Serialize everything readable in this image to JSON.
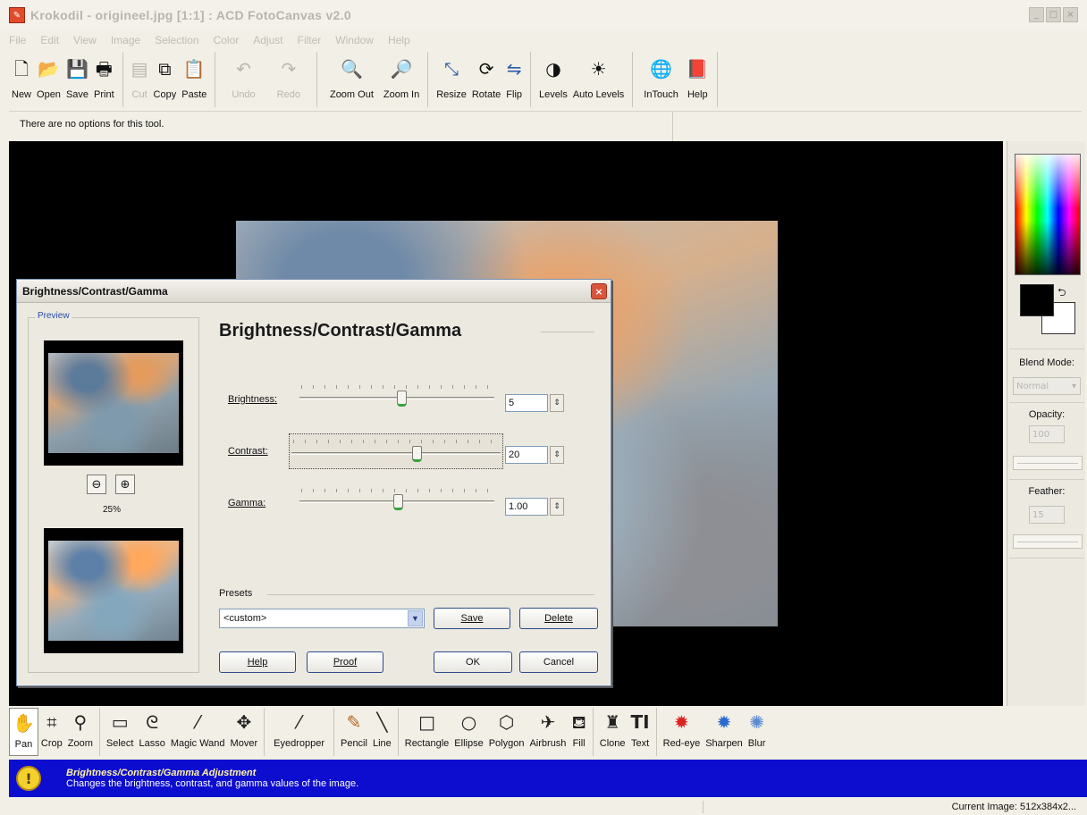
{
  "window": {
    "title": "Krokodil - origineel.jpg [1:1] : ACD FotoCanvas v2.0",
    "controls": [
      "_",
      "□",
      "×"
    ]
  },
  "menu": [
    "File",
    "Edit",
    "View",
    "Image",
    "Selection",
    "Color",
    "Adjust",
    "Filter",
    "Window",
    "Help"
  ],
  "toolbar": {
    "new": "New",
    "open": "Open",
    "save": "Save",
    "print": "Print",
    "cut": "Cut",
    "copy": "Copy",
    "paste": "Paste",
    "undo": "Undo",
    "redo": "Redo",
    "zoom_out": "Zoom Out",
    "zoom_in": "Zoom In",
    "resize": "Resize",
    "rotate": "Rotate",
    "flip": "Flip",
    "levels": "Levels",
    "auto_levels": "Auto Levels",
    "intouch": "InTouch",
    "help": "Help"
  },
  "options_bar": {
    "text": "There are no options for this tool."
  },
  "palette": {
    "blend_mode_label": "Blend Mode:",
    "blend_mode_value": "Normal",
    "opacity_label": "Opacity:",
    "opacity_value": "100",
    "feather_label": "Feather:",
    "feather_value": "15"
  },
  "tools": {
    "pan": "Pan",
    "crop": "Crop",
    "zoom": "Zoom",
    "select": "Select",
    "lasso": "Lasso",
    "magic_wand": "Magic Wand",
    "mover": "Mover",
    "eyedropper": "Eyedropper",
    "pencil": "Pencil",
    "line": "Line",
    "rectangle": "Rectangle",
    "ellipse": "Ellipse",
    "polygon": "Polygon",
    "airbrush": "Airbrush",
    "fill": "Fill",
    "clone": "Clone",
    "text": "Text",
    "red_eye": "Red-eye",
    "sharpen": "Sharpen",
    "blur": "Blur"
  },
  "hint": {
    "title": "Brightness/Contrast/Gamma Adjustment",
    "description": "Changes the brightness, contrast, and gamma values of the image."
  },
  "status": {
    "current_image": "Current Image: 512x384x2..."
  },
  "dialog": {
    "title": "Brightness/Contrast/Gamma",
    "heading": "Brightness/Contrast/Gamma",
    "preview_label": "Preview",
    "zoom_percent": "25%",
    "brightness_label": "Brightness:",
    "brightness_value": "5",
    "brightness_level": 0.52,
    "contrast_label": "Contrast:",
    "contrast_value": "20",
    "contrast_level": 0.6,
    "gamma_label": "Gamma:",
    "gamma_value": "1.00",
    "gamma_level": 0.5,
    "presets_label": "Presets",
    "presets_value": "<custom>",
    "save_button": "Save",
    "delete_button": "Delete",
    "help_button": "Help",
    "proof_button": "Proof",
    "ok_button": "OK",
    "cancel_button": "Cancel"
  },
  "colors": {
    "hint_bar": "#0d0dcf",
    "foreground": "#000000",
    "background": "#ffffff",
    "canvas": "#000000"
  }
}
